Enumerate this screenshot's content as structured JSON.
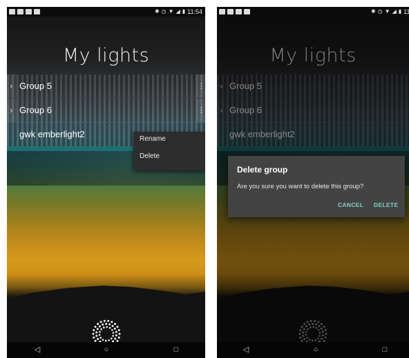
{
  "status_bar": {
    "time": "11:54"
  },
  "screen_title": "My lights",
  "groups": [
    {
      "name": "Group 5"
    },
    {
      "name": "Group 6"
    },
    {
      "name": "gwk emberlight2"
    }
  ],
  "context_menu": {
    "items": [
      "Rename",
      "Delete"
    ]
  },
  "dialog": {
    "title": "Delete group",
    "message": "Are you sure you want to delete this group?",
    "cancel_label": "CANCEL",
    "delete_label": "DELETE"
  },
  "icons": {
    "chevron": "chevron-right-icon",
    "more": "more-vertical-icon",
    "logo": "emberlight-sunburst-icon",
    "nav_back": "back-triangle-icon",
    "nav_home": "home-circle-icon",
    "nav_recents": "recents-square-icon"
  },
  "colors": {
    "dialog_accent": "#7fd0c6",
    "dialog_bg": "#434343"
  }
}
